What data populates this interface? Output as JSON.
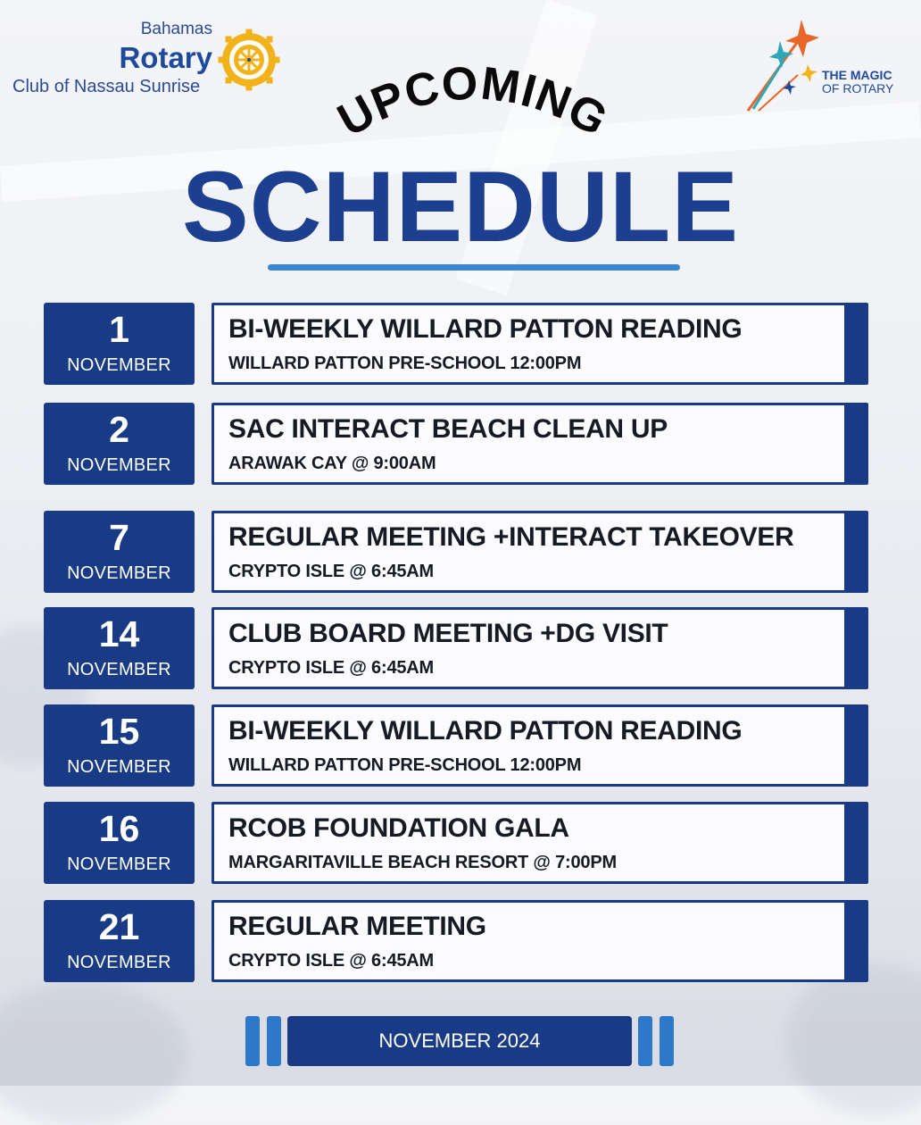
{
  "header": {
    "logo_left": {
      "line1": "Bahamas",
      "line2": "Rotary",
      "line3": "Club of Nassau Sunrise",
      "icon": "rotary-wheel-icon"
    },
    "logo_right": {
      "line1": "THE MAGIC",
      "line2": "OF ROTARY",
      "icon": "stars-icon"
    },
    "upcoming": "UPCOMING",
    "schedule": "SCHEDULE"
  },
  "colors": {
    "navy": "#193b86",
    "heading": "#1c3f8f",
    "accent": "#3a86d0"
  },
  "events": [
    {
      "day": "1",
      "month": "NOVEMBER",
      "title": "BI-WEEKLY WILLARD PATTON READING",
      "detail": "WILLARD PATTON PRE-SCHOOL 12:00PM"
    },
    {
      "day": "2",
      "month": "NOVEMBER",
      "title": "SAC INTERACT BEACH CLEAN UP",
      "detail": "ARAWAK CAY @ 9:00AM"
    },
    {
      "day": "7",
      "month": "NOVEMBER",
      "title": "REGULAR MEETING +INTERACT TAKEOVER",
      "detail": "CRYPTO ISLE @ 6:45AM"
    },
    {
      "day": "14",
      "month": "NOVEMBER",
      "title": "CLUB BOARD MEETING +DG VISIT",
      "detail": "CRYPTO ISLE @ 6:45AM"
    },
    {
      "day": "15",
      "month": "NOVEMBER",
      "title": "BI-WEEKLY WILLARD PATTON READING",
      "detail": "WILLARD PATTON PRE-SCHOOL 12:00PM"
    },
    {
      "day": "16",
      "month": "NOVEMBER",
      "title": "RCOB FOUNDATION GALA",
      "detail": "MARGARITAVILLE BEACH RESORT @ 7:00PM"
    },
    {
      "day": "21",
      "month": "NOVEMBER",
      "title": "REGULAR MEETING",
      "detail": "CRYPTO ISLE @ 6:45AM"
    }
  ],
  "footer": {
    "label": "NOVEMBER 2024"
  }
}
